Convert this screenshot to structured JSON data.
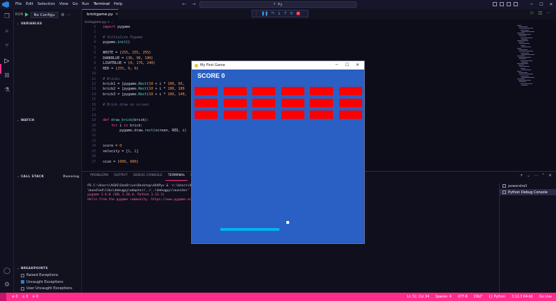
{
  "titlebar": {
    "menu": [
      "File",
      "Edit",
      "Selection",
      "View",
      "Go",
      "Run",
      "Terminal",
      "Help"
    ],
    "search_text": "Py",
    "search_icon": "search-icon"
  },
  "sidebar": {
    "run_label": "RUN",
    "config": "No Configu",
    "variables_header": "VARIABLES",
    "watch_header": "WATCH",
    "callstack_header": "CALL STACK",
    "callstack_status": "Running",
    "breakpoints_header": "BREAKPOINTS",
    "breakpoints": [
      {
        "label": "Raised Exceptions",
        "checked": false
      },
      {
        "label": "Uncaught Exceptions",
        "checked": true
      },
      {
        "label": "User Uncaught Exceptions",
        "checked": false
      }
    ]
  },
  "editor": {
    "tab_label": "brickgame.py",
    "breadcrumb": "brickgame.py > ...",
    "lines": [
      {
        "n": "1",
        "html": "<span class=\"kw\">import</span> pygame"
      },
      {
        "n": "2",
        "html": ""
      },
      {
        "n": "3",
        "html": "<span class=\"cm\"># Initialize Pygame</span>"
      },
      {
        "n": "4",
        "html": "pygame.<span class=\"fn\">init</span>()"
      },
      {
        "n": "5",
        "html": ""
      },
      {
        "n": "6",
        "html": "WHITE = (<span class=\"nm\">255</span>, <span class=\"nm\">255</span>, <span class=\"nm\">255</span>)"
      },
      {
        "n": "7",
        "html": "DARKBLUE = (<span class=\"nm\">36</span>, <span class=\"nm\">90</span>, <span class=\"nm\">190</span>)"
      },
      {
        "n": "8",
        "html": "LIGHTBLUE = (<span class=\"nm\">0</span>, <span class=\"nm\">176</span>, <span class=\"nm\">240</span>)"
      },
      {
        "n": "9",
        "html": "RED = (<span class=\"nm\">255</span>, <span class=\"nm\">0</span>, <span class=\"nm\">0</span>)"
      },
      {
        "n": "10",
        "html": ""
      },
      {
        "n": "11",
        "html": "<span class=\"cm\"># Bricks</span>"
      },
      {
        "n": "12",
        "html": "brick1 = [pygame.<span class=\"fn\">Rect</span>(<span class=\"nm\">10</span> + i * <span class=\"nm\">100</span>, <span class=\"nm\">60</span>,"
      },
      {
        "n": "13",
        "html": "brick2 = [pygame.<span class=\"fn\">Rect</span>(<span class=\"nm\">10</span> + i * <span class=\"nm\">100</span>, <span class=\"nm\">100</span>"
      },
      {
        "n": "14",
        "html": "brick3 = [pygame.<span class=\"fn\">Rect</span>(<span class=\"nm\">10</span> + i * <span class=\"nm\">100</span>, <span class=\"nm\">140</span>,"
      },
      {
        "n": "15",
        "html": ""
      },
      {
        "n": "16",
        "html": "<span class=\"cm\"># Brick draw on screen</span>"
      },
      {
        "n": "17",
        "html": ""
      },
      {
        "n": "18",
        "html": ""
      },
      {
        "n": "19",
        "html": "<span class=\"kw\">def</span> <span class=\"fn\">draw_brick</span>(brick):"
      },
      {
        "n": "20",
        "html": "    <span class=\"kw\">for</span> i <span class=\"kw\">in</span> brick:"
      },
      {
        "n": "21",
        "html": "        pygame.draw.<span class=\"fn\">rect</span>(screen, RED, i)"
      },
      {
        "n": "22",
        "html": ""
      },
      {
        "n": "23",
        "html": ""
      },
      {
        "n": "24",
        "html": "score = <span class=\"nm\">0</span>"
      },
      {
        "n": "25",
        "html": "velocity = [<span class=\"nm\">1</span>, <span class=\"nm\">1</span>]"
      },
      {
        "n": "26",
        "html": ""
      },
      {
        "n": "27",
        "html": "size = (<span class=\"nm\">600</span>, <span class=\"nm\">600</span>)"
      }
    ]
  },
  "panel": {
    "tabs": [
      "PROBLEMS",
      "OUTPUT",
      "DEBUG CONSOLE",
      "TERMINAL",
      "PORTS"
    ],
    "active_tab": "TERMINAL",
    "terminal_lines": [
      {
        "text": "PS C:\\Users\\ASUS\\OneDrive\\Desktop\\AAVPy>  & 'c:\\Users\\ASUS\\...\\extensions\\ms-python.debugpy-2024.0.0-win32-x64",
        "pink": false
      },
      {
        "text": "\\bundled\\libs\\debugpy\\adapter/../..\\debugpy\\launcher' ...",
        "pink": false
      },
      {
        "text": "pygame 2.6.0 (SDL 2.28.4, Python 3.12.3)",
        "pink": true
      },
      {
        "text": "Hello from the pygame community. https://www.pygame.org/contribute.html",
        "pink": true
      }
    ],
    "terminals": [
      {
        "label": "powershell",
        "selected": false
      },
      {
        "label": "Python Debug Console",
        "selected": true
      }
    ]
  },
  "statusbar": {
    "left": [
      "⊗ 0",
      "⚠ 0",
      "⟳ 0"
    ],
    "right": [
      "Ln 32, Col 34",
      "Spaces: 4",
      "UTF-8",
      "CRLF",
      "{} Python",
      "3.12.3 64-bit",
      "Go Live"
    ]
  },
  "game": {
    "window_title": "My First Game",
    "score_label": "SCORE 0",
    "colors": {
      "background": "#2a5fc4",
      "brick": "#ff0000",
      "paddle": "#00b4f0",
      "ball": "#ffffff"
    },
    "brick_rows": 3,
    "brick_cols": 6
  }
}
